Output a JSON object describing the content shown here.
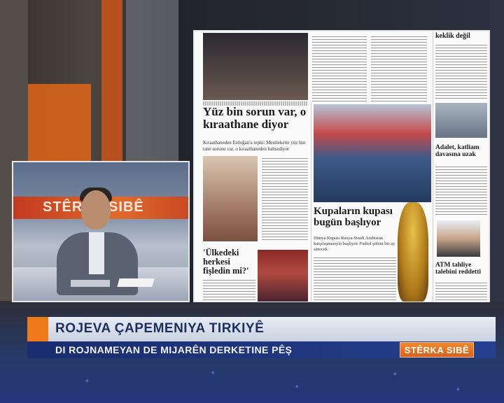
{
  "inset": {
    "banner_text": "STÊRKA SIBÊ"
  },
  "newspaper": {
    "headline_1": "Yüz bin sorun var, o kıraathane diyor",
    "deck_1": "Kıraathaneden Erdoğan'a tepki: Memlekette yüz bin tane sorunu var, o kıraathaneden bahsediyor",
    "headline_2": "Kupaların kupası bugün başlıyor",
    "deck_2": "Dünya Kupası Rusya-Suudi Arabistan karşılaşmasıyla başlıyor. Futbol şöleni bir ay sürecek",
    "headline_3": "'Ülkedeki herkesi fişledin mi?'",
    "right_headline_1": "keklik değil",
    "right_headline_2": "Adalet, katliam davasına uzak",
    "right_headline_3": "ATM tahliye talebini reddetti"
  },
  "lower_third": {
    "title": "ROJEVA ÇAPEMENIYA TIRKIYÊ",
    "subtitle": "DI ROJNAMEYAN DE MIJARÊN DERKETINE PÊŞ",
    "badge": "STÊRKA SIBÊ"
  },
  "colors": {
    "accent_orange": "#f07a1a",
    "navy": "#1a2c6e"
  }
}
